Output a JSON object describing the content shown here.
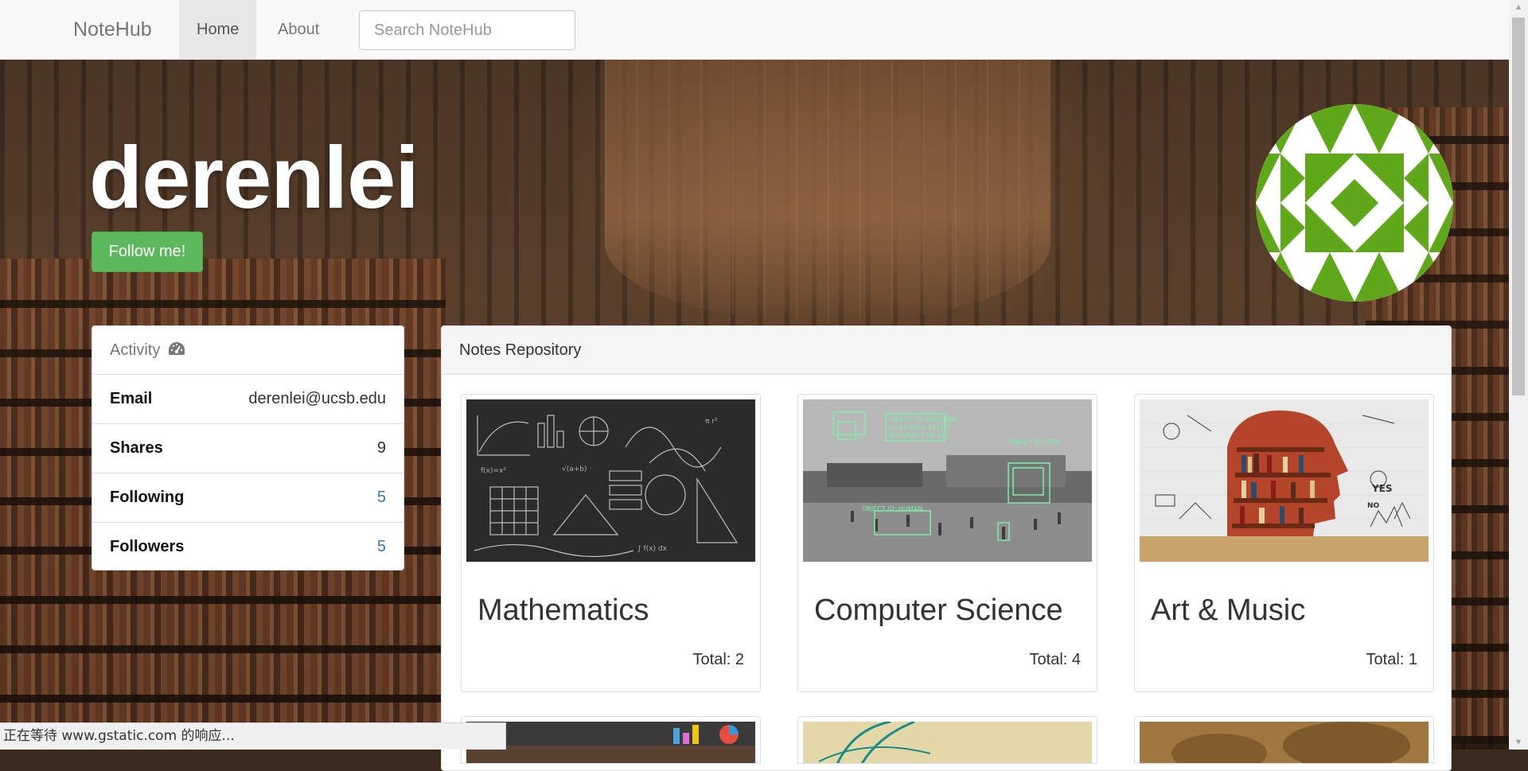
{
  "navbar": {
    "brand": "NoteHub",
    "items": [
      {
        "label": "Home",
        "active": true
      },
      {
        "label": "About",
        "active": false
      }
    ],
    "search_placeholder": "Search NoteHub",
    "search_value": ""
  },
  "profile": {
    "username": "derenlei",
    "follow_label": "Follow me!",
    "avatar_icon": "identicon-avatar",
    "avatar_color": "#5fa819"
  },
  "activity": {
    "title": "Activity",
    "icon": "dashboard-icon",
    "rows": [
      {
        "label": "Email",
        "value": "derenlei@ucsb.edu"
      },
      {
        "label": "Shares",
        "value": "9"
      },
      {
        "label": "Following",
        "value": "5"
      },
      {
        "label": "Followers",
        "value": "5"
      }
    ]
  },
  "notes": {
    "title": "Notes Repository",
    "cards": [
      {
        "title": "Mathematics",
        "total": "Total: 2",
        "image": "chalkboard-math-image"
      },
      {
        "title": "Computer Science",
        "total": "Total: 4",
        "image": "object-detection-image"
      },
      {
        "title": "Art & Music",
        "total": "Total: 1",
        "image": "bookshelf-head-image"
      }
    ]
  },
  "status_bar": {
    "text": "正在等待 www.gstatic.com 的响应..."
  },
  "colors": {
    "follow_button": "#5cb85c",
    "link": "#337ab7"
  }
}
